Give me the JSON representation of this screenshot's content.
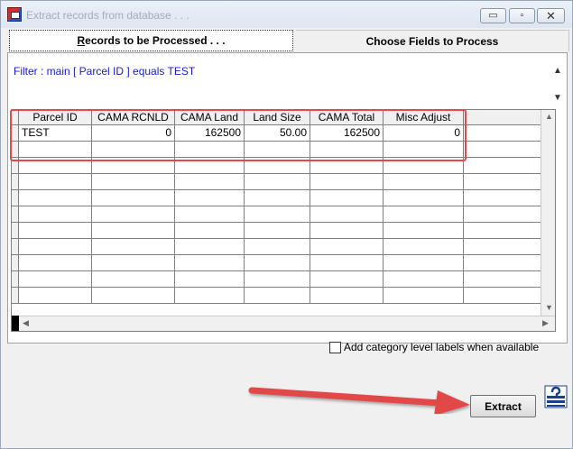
{
  "window": {
    "title": "Extract records from database . . .",
    "controls": {
      "minimize": "▭",
      "restore": "▫",
      "close": "✕"
    }
  },
  "tabs": [
    {
      "label": "Records to be Processed . . .",
      "active": true
    },
    {
      "label": "Choose Fields to Process",
      "active": false
    }
  ],
  "filter": {
    "text": "Filter : main [ Parcel ID ] equals TEST"
  },
  "table": {
    "columns": [
      "Parcel ID",
      "CAMA RCNLD",
      "CAMA Land",
      "Land Size",
      "CAMA Total",
      "Misc Adjust"
    ],
    "rows": [
      [
        "TEST",
        "0",
        "162500",
        "50.00",
        "162500",
        "0"
      ]
    ]
  },
  "options": {
    "category_labels": "Add category level labels when available",
    "category_labels_checked": false
  },
  "actions": {
    "extract_label": "Extract"
  },
  "colors": {
    "annotation": "#e14a4a",
    "filter_text": "#1a1acc"
  },
  "icons": {
    "app": "app-icon",
    "help": "help-icon"
  }
}
